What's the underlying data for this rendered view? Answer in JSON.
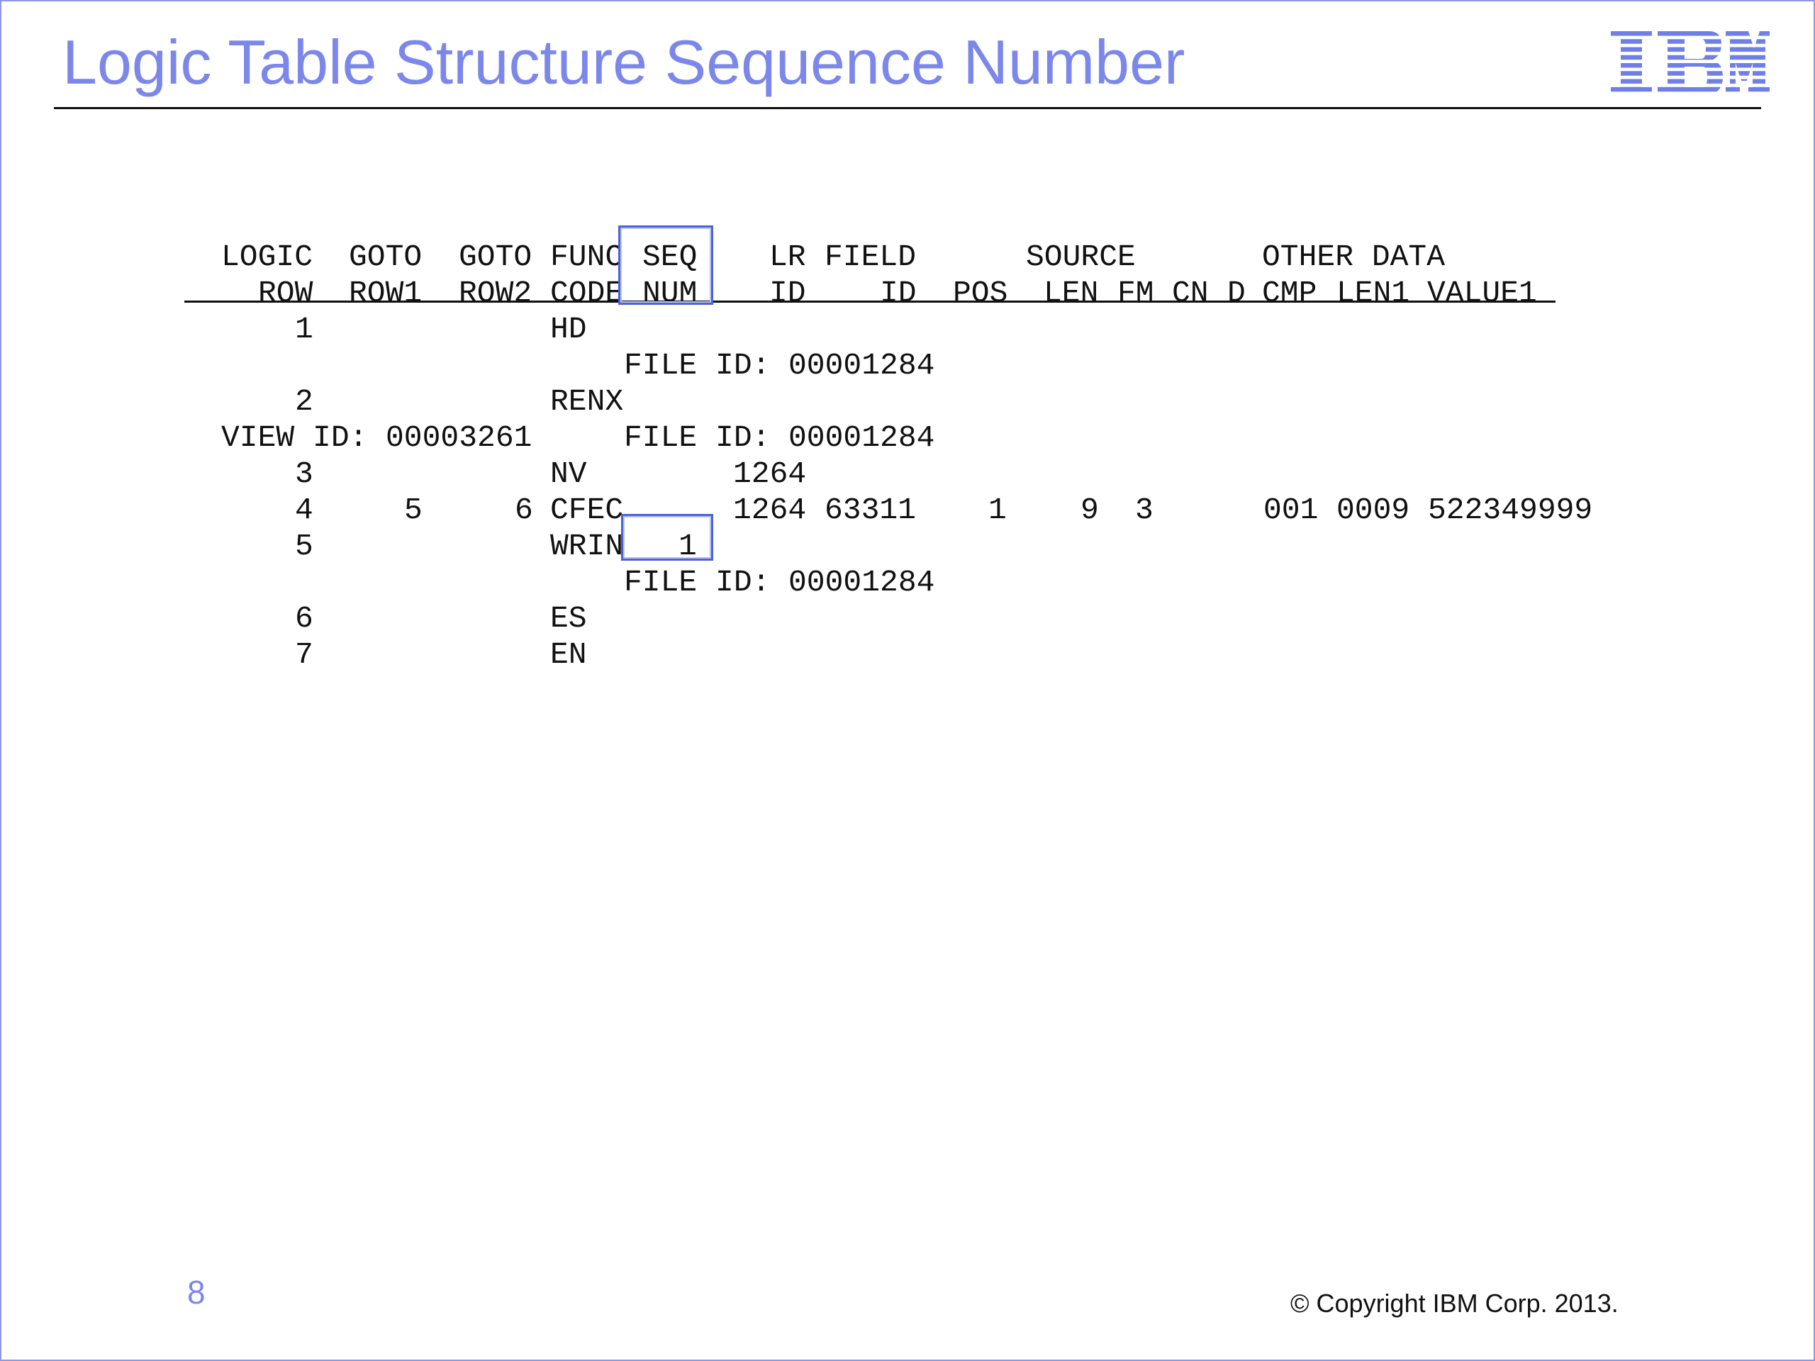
{
  "slide": {
    "title": "Logic Table Structure Sequence Number",
    "logo_text": "IBM",
    "page_number": "8",
    "copyright": "© Copyright IBM Corp. 2013.",
    "colors": {
      "accent": "#7b87ea",
      "highlight": "#4a63d8",
      "text": "#111111"
    }
  },
  "listing": {
    "header": {
      "logic": [
        "LOGIC",
        "ROW"
      ],
      "goto1": [
        "GOTO",
        "ROW1"
      ],
      "goto2": [
        "GOTO",
        "ROW2"
      ],
      "func": [
        "FUNC",
        "CODE"
      ],
      "seq": [
        "SEQ",
        "NUM"
      ],
      "lr": [
        "LR",
        "ID"
      ],
      "field": [
        "FIELD",
        "ID"
      ],
      "source": "SOURCE",
      "other": "OTHER DATA",
      "pos": "POS",
      "len": "LEN",
      "fm": "FM",
      "cn": "CN",
      "d": "D",
      "cmp": "CMP",
      "len1": "LEN1",
      "value1": "VALUE1"
    },
    "rows": {
      "r1": {
        "row": "1",
        "func": "HD",
        "file_label": "FILE ID:",
        "file_id": "00001284"
      },
      "r2": {
        "row": "2",
        "func": "RENX",
        "view_label": "VIEW ID:",
        "view_id": "00003261",
        "file_label": "FILE ID:",
        "file_id": "00001284"
      },
      "r3": {
        "row": "3",
        "func": "NV",
        "lr": "1264"
      },
      "r4": {
        "row": "4",
        "goto1": "5",
        "goto2": "6",
        "func": "CFEC",
        "lr": "1264",
        "field": "63311",
        "pos": "1",
        "len": "9",
        "fm": "3",
        "cmp": "001",
        "len1": "0009",
        "value1": "522349999"
      },
      "r5": {
        "row": "5",
        "func": "WRIN",
        "seq": "1",
        "file_label": "FILE ID:",
        "file_id": "00001284"
      },
      "r6": {
        "row": "6",
        "func": "ES"
      },
      "r7": {
        "row": "7",
        "func": "EN"
      }
    }
  }
}
